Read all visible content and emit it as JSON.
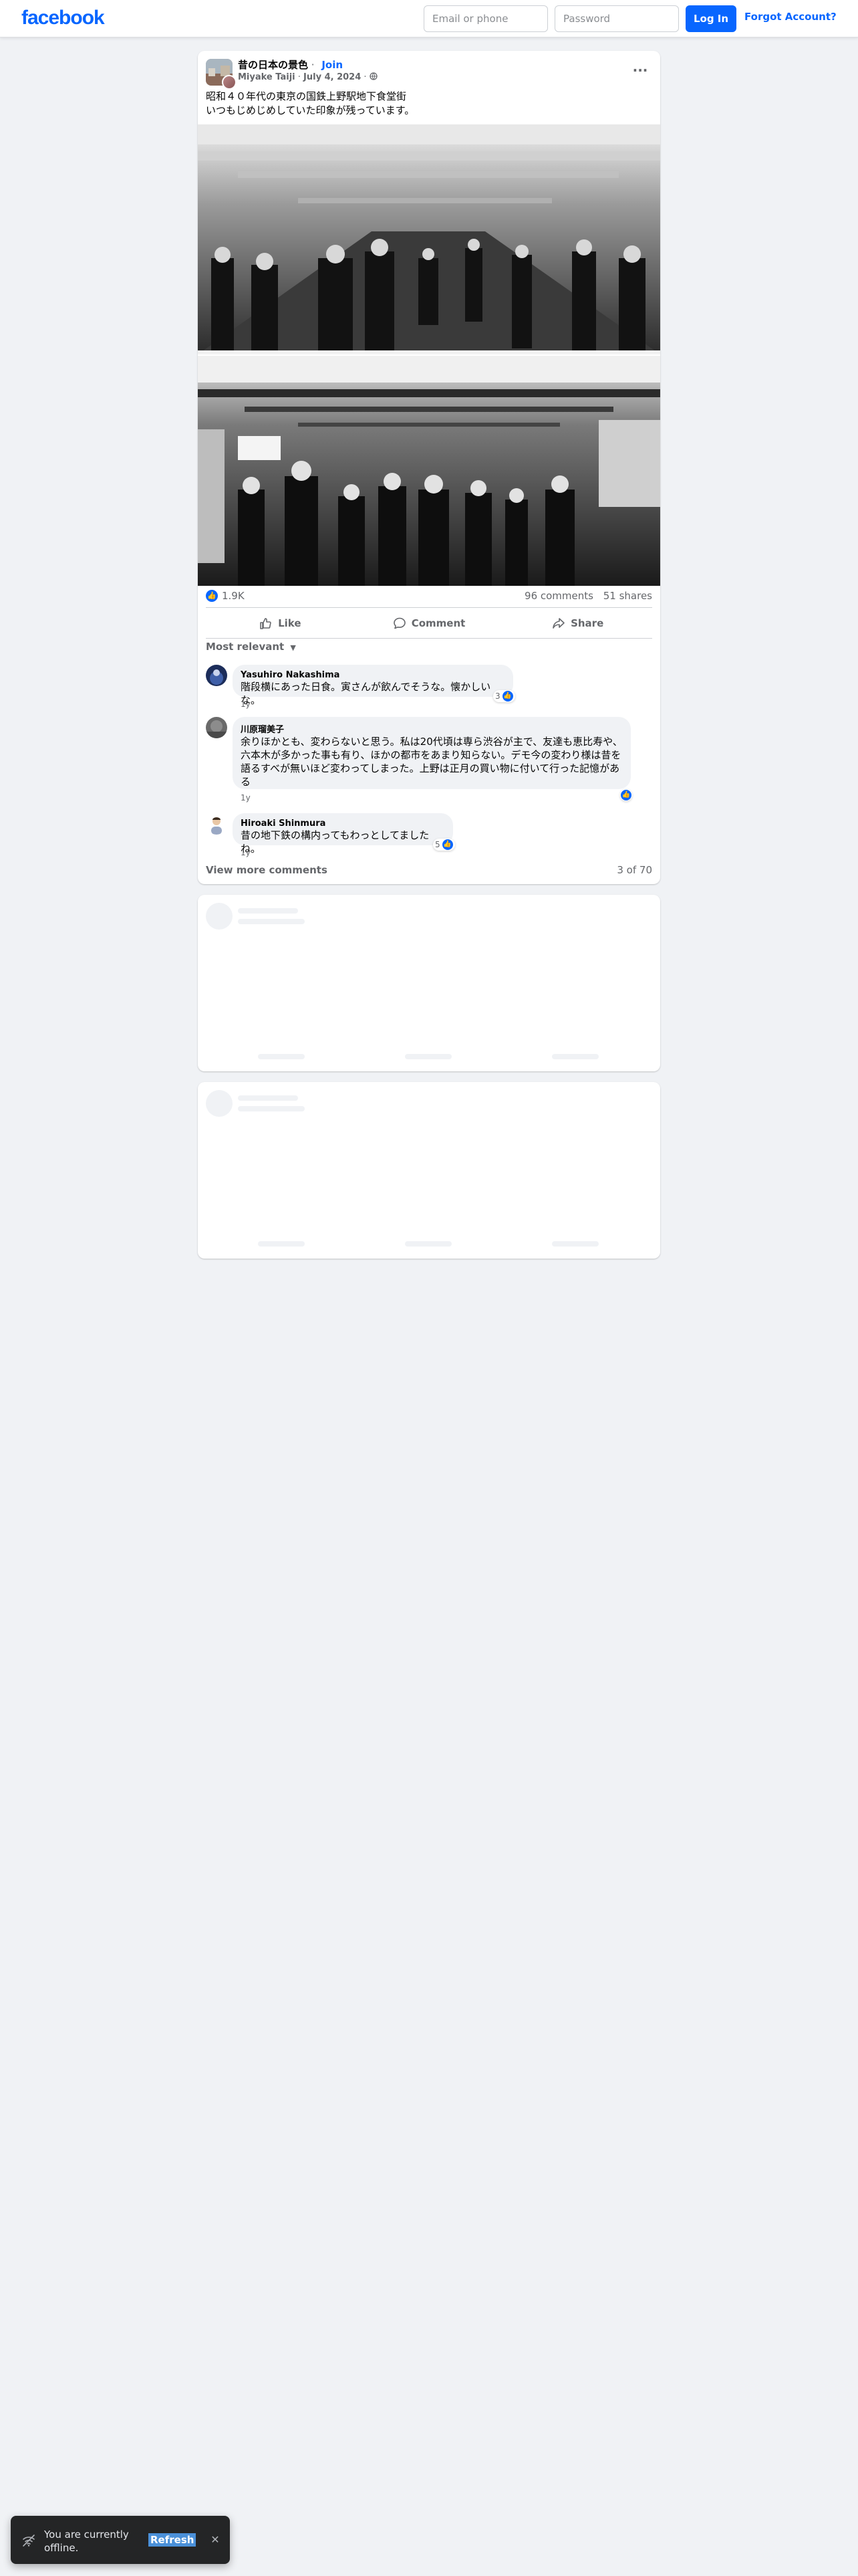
{
  "header": {
    "logo": "facebook",
    "email_placeholder": "Email or phone",
    "password_placeholder": "Password",
    "login_label": "Log In",
    "forgot_label": "Forgot Account?"
  },
  "post": {
    "group_name": "昔の日本の景色",
    "join_label": "Join",
    "separator": " · ",
    "author": "Miyake Taiji",
    "date": "July 4, 2024",
    "privacy_icon": "globe-icon",
    "more_icon": "more-options-icon",
    "text_line1": "昭和４０年代の東京の国鉄上野駅地下食堂街",
    "text_line2": "いつもじめじめしていた印象が残っています。",
    "reaction_count": "1.9K",
    "comments_count": "96 comments",
    "shares_count": "51 shares",
    "actions": {
      "like": "Like",
      "comment": "Comment",
      "share": "Share"
    },
    "sort_label": "Most relevant",
    "comments": [
      {
        "name": "Yasuhiro Nakashima",
        "text": "階段横にあった日食。寅さんが飲んでそうな。懐かしいな。",
        "time": "1y",
        "reactions": "3"
      },
      {
        "name": "川原瑠美子",
        "text": "余りほかとも、変わらないと思う。私は20代頃は専ら渋谷が主で、友達も恵比寿や、六本木が多かった事も有り、ほかの都市をあまり知らない。デモ今の変わり様は昔を語るすべが無いほど変わってしまった。上野は正月の買い物に付いて行った記憶がある",
        "time": "1y",
        "reactions": ""
      },
      {
        "name": "Hiroaki Shinmura",
        "text": "昔の地下鉄の構内ってもわっとしてましたね。",
        "time": "1y",
        "reactions": "5"
      }
    ],
    "view_more_label": "View more comments",
    "page_count": "3 of 70"
  },
  "toast": {
    "message": "You are currently offline.",
    "refresh_label": "Refresh",
    "close_icon": "close-icon"
  },
  "colors": {
    "brand": "#0866ff",
    "background": "#f0f2f5",
    "secondary_text": "#65676b"
  }
}
